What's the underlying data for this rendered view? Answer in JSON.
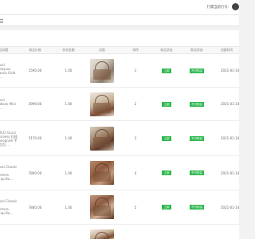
{
  "topbar": {
    "greeting": "行需当前行号:"
  },
  "table": {
    "headers": [
      "商品标题",
      "商品价格",
      "折扣金额",
      "封面",
      "排序",
      "商品状态",
      "购买状态",
      "创建时间"
    ],
    "rows": [
      {
        "name": "Gucci Dionysus\nClassic Gold\nBa...",
        "price": "1590.00",
        "discount": "1.00",
        "order": "1",
        "status": "上架",
        "buy": "不可购买",
        "time": "2021-01-14"
      },
      {
        "name": "Gucci\nPadlock Mini\nBa...",
        "price": "2999.00",
        "discount": "1.00",
        "order": "2",
        "status": "上架",
        "buy": "不可购买",
        "time": "2021-01-14"
      },
      {
        "name": "GUCCI Gucci\nBusiness 拉链\nMonogram 手\n提包包 ...",
        "price": "5170.00",
        "discount": "1.00",
        "order": "3",
        "status": "上架",
        "buy": "不可购买",
        "time": "2021-01-14"
      },
      {
        "name": "Gucci Classic G\nCamera\nStrap Ba...",
        "price": "7800.00",
        "discount": "1.00",
        "order": "4",
        "status": "上架",
        "buy": "不可购买",
        "time": "2021-01-14"
      },
      {
        "name": "Gucci Classic G\nCamera\nStrap Ba...",
        "price": "7800.00",
        "discount": "1.00",
        "order": "5",
        "status": "上架",
        "buy": "不可购买",
        "time": "2021-01-14"
      }
    ]
  }
}
